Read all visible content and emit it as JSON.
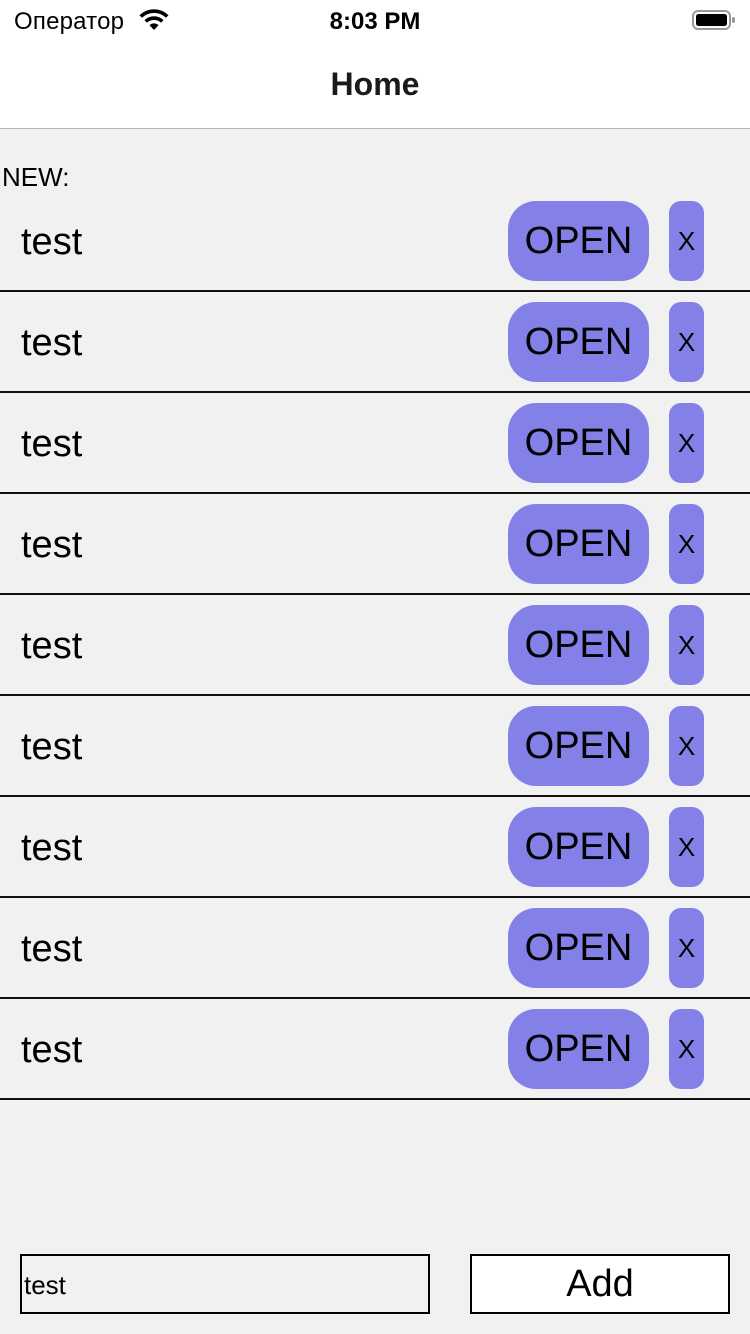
{
  "status_bar": {
    "carrier": "Оператор",
    "time": "8:03 PM"
  },
  "nav": {
    "title": "Home"
  },
  "section": {
    "label": "NEW:"
  },
  "items": [
    {
      "label": "test",
      "open_label": "OPEN",
      "remove_label": "X"
    },
    {
      "label": "test",
      "open_label": "OPEN",
      "remove_label": "X"
    },
    {
      "label": "test",
      "open_label": "OPEN",
      "remove_label": "X"
    },
    {
      "label": "test",
      "open_label": "OPEN",
      "remove_label": "X"
    },
    {
      "label": "test",
      "open_label": "OPEN",
      "remove_label": "X"
    },
    {
      "label": "test",
      "open_label": "OPEN",
      "remove_label": "X"
    },
    {
      "label": "test",
      "open_label": "OPEN",
      "remove_label": "X"
    },
    {
      "label": "test",
      "open_label": "OPEN",
      "remove_label": "X"
    },
    {
      "label": "test",
      "open_label": "OPEN",
      "remove_label": "X"
    }
  ],
  "input": {
    "value": "test"
  },
  "add_button": {
    "label": "Add"
  },
  "colors": {
    "button_accent": "#8381e8",
    "background": "#f1f1f1"
  }
}
